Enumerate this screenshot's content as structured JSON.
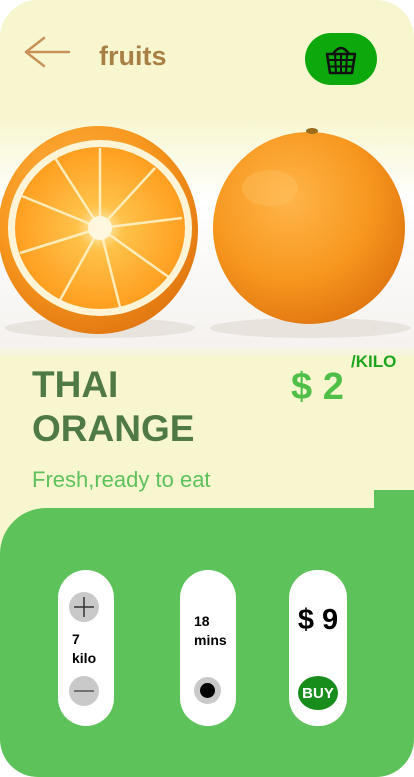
{
  "header": {
    "title": "fruits",
    "back_icon": "back-arrow-icon",
    "cart_icon": "basket-icon"
  },
  "product": {
    "name_line1": "THAI",
    "name_line2": "ORANGE",
    "price": "$ 2",
    "unit": "/KILO",
    "tagline": "Fresh,ready to eat"
  },
  "controls": {
    "quantity": {
      "value": "7",
      "unit": "kilo",
      "increment_icon": "plus-icon",
      "decrement_icon": "minus-icon"
    },
    "delivery": {
      "value": "18",
      "unit": "mins",
      "icon": "radio-dot-icon"
    },
    "order": {
      "total": "$ 9",
      "buy_label": "BUY"
    }
  },
  "colors": {
    "background": "#f8f6cf",
    "title": "#a88046",
    "product_name": "#4f7a45",
    "price": "#4fbf48",
    "panel": "#5ec25b",
    "cart_button": "#0ca80c",
    "buy_button": "#198d1c"
  }
}
